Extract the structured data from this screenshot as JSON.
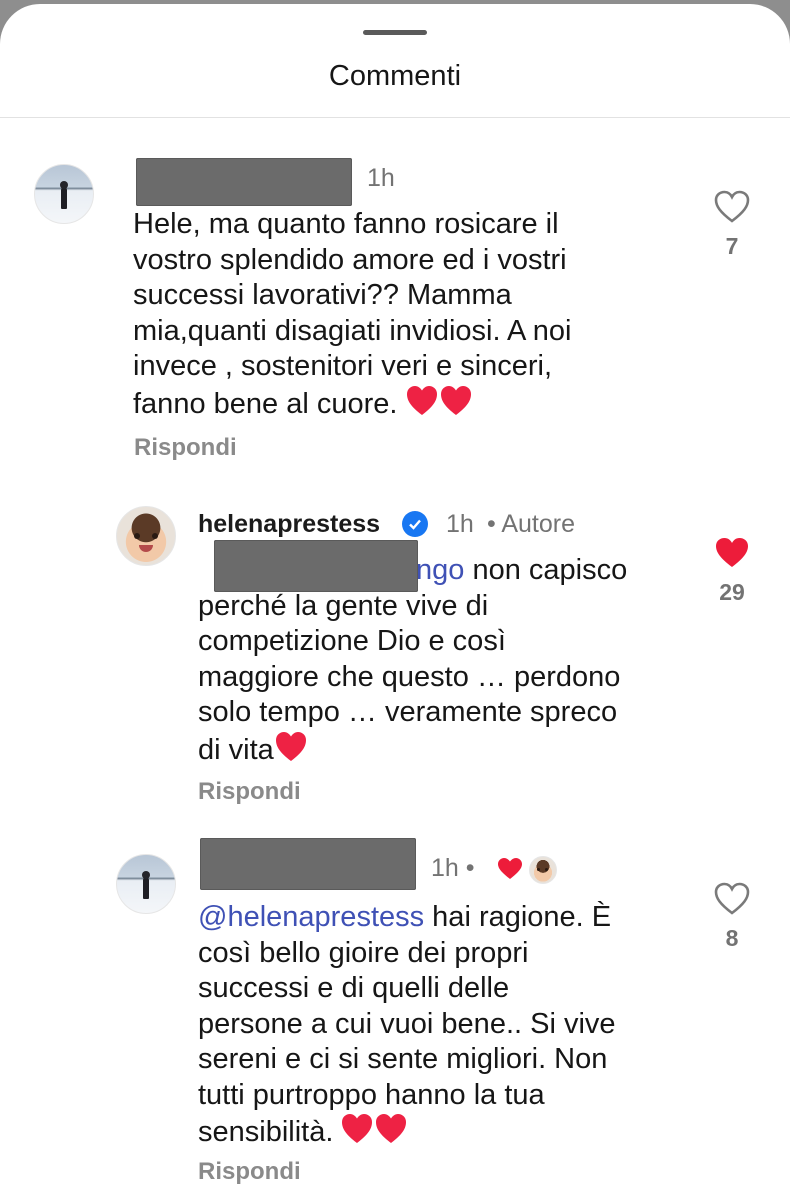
{
  "header": {
    "title": "Commenti"
  },
  "comments": [
    {
      "time": "1h",
      "text": "Hele, ma quanto fanno rosicare il\nvostro splendido amore ed i vostri\nsuccessi lavorativi?? Mamma\nmia,quanti disagiati invidiosi. A noi\ninvece , sostenitori veri e sinceri,\nfanno bene al cuore.",
      "emoji": "❤️❤️",
      "reply_label": "Rispondi",
      "like_count": "7",
      "liked": false
    },
    {
      "username": "helenaprestess",
      "verified": true,
      "time": "1h",
      "author_tag": "• Autore",
      "mention_tail": "ngo",
      "text_first": " non capisco",
      "text": "perché la gente vive di\ncompetizione Dio e così\nmaggiore che questo … perdono\nsolo tempo … veramente spreco\ndi vita",
      "emoji": "❤️",
      "reply_label": "Rispondi",
      "like_count": "29",
      "liked": true
    },
    {
      "time": "1h •",
      "mention": "@helenaprestess",
      "text_first": " hai ragione. È",
      "text": "così bello gioire dei propri\nsuccessi e di quelli delle\npersone a cui vuoi bene.. Si vive\nsereni e ci si sente migliori. Non\ntutti purtroppo hanno la tua\nsensibilità.",
      "emoji": "❤️❤️",
      "reply_label": "Rispondi",
      "like_count": "8",
      "liked": false
    }
  ],
  "colors": {
    "accent_mention": "#3f51b5",
    "liked_heart": "#ed1c3a",
    "verified": "#1877f2"
  }
}
